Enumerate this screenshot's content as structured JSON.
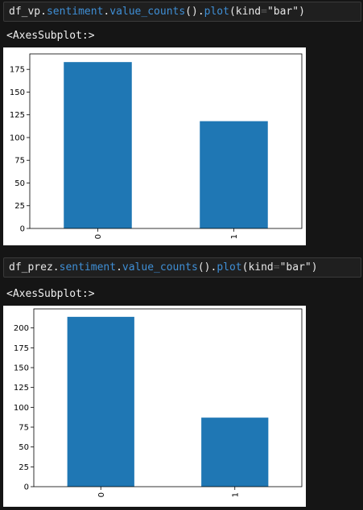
{
  "cells": [
    {
      "code": {
        "object": "df_vp",
        "dot1": ".",
        "attr1": "sentiment",
        "dot2": ".",
        "method1": "value_counts",
        "paren1": "()",
        "dot3": ".",
        "method2": "plot",
        "open": "(",
        "kw": "kind",
        "eq": "=",
        "str": "\"bar\"",
        "close": ")"
      },
      "output_label": "<AxesSubplot:>"
    },
    {
      "code": {
        "object": "df_prez",
        "dot1": ".",
        "attr1": "sentiment",
        "dot2": ".",
        "method1": "value_counts",
        "paren1": "()",
        "dot3": ".",
        "method2": "plot",
        "open": "(",
        "kw": "kind",
        "eq": "=",
        "str": "\"bar\"",
        "close": ")"
      },
      "output_label": "<AxesSubplot:>"
    }
  ],
  "chart_data": [
    {
      "type": "bar",
      "categories": [
        "0",
        "1"
      ],
      "values": [
        183,
        118
      ],
      "ylim": [
        0,
        192
      ],
      "yticks": [
        0,
        25,
        50,
        75,
        100,
        125,
        150,
        175
      ],
      "bar_color": "#1f77b4"
    },
    {
      "type": "bar",
      "categories": [
        "0",
        "1"
      ],
      "values": [
        214,
        87
      ],
      "ylim": [
        0,
        224
      ],
      "yticks": [
        0,
        25,
        50,
        75,
        100,
        125,
        150,
        175,
        200
      ],
      "bar_color": "#1f77b4"
    }
  ]
}
